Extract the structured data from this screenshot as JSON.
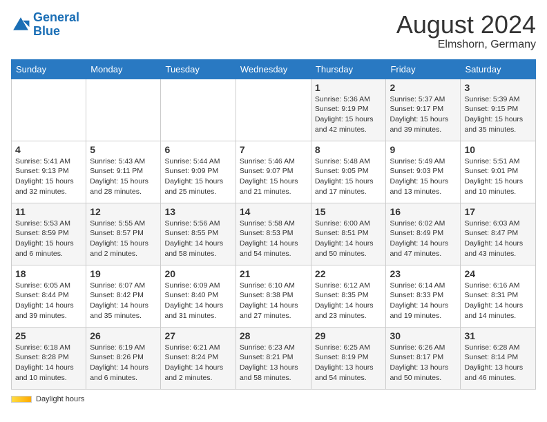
{
  "header": {
    "logo_general": "General",
    "logo_blue": "Blue",
    "month_year": "August 2024",
    "location": "Elmshorn, Germany"
  },
  "days_of_week": [
    "Sunday",
    "Monday",
    "Tuesday",
    "Wednesday",
    "Thursday",
    "Friday",
    "Saturday"
  ],
  "weeks": [
    [
      {
        "num": "",
        "info": ""
      },
      {
        "num": "",
        "info": ""
      },
      {
        "num": "",
        "info": ""
      },
      {
        "num": "",
        "info": ""
      },
      {
        "num": "1",
        "info": "Sunrise: 5:36 AM\nSunset: 9:19 PM\nDaylight: 15 hours\nand 42 minutes."
      },
      {
        "num": "2",
        "info": "Sunrise: 5:37 AM\nSunset: 9:17 PM\nDaylight: 15 hours\nand 39 minutes."
      },
      {
        "num": "3",
        "info": "Sunrise: 5:39 AM\nSunset: 9:15 PM\nDaylight: 15 hours\nand 35 minutes."
      }
    ],
    [
      {
        "num": "4",
        "info": "Sunrise: 5:41 AM\nSunset: 9:13 PM\nDaylight: 15 hours\nand 32 minutes."
      },
      {
        "num": "5",
        "info": "Sunrise: 5:43 AM\nSunset: 9:11 PM\nDaylight: 15 hours\nand 28 minutes."
      },
      {
        "num": "6",
        "info": "Sunrise: 5:44 AM\nSunset: 9:09 PM\nDaylight: 15 hours\nand 25 minutes."
      },
      {
        "num": "7",
        "info": "Sunrise: 5:46 AM\nSunset: 9:07 PM\nDaylight: 15 hours\nand 21 minutes."
      },
      {
        "num": "8",
        "info": "Sunrise: 5:48 AM\nSunset: 9:05 PM\nDaylight: 15 hours\nand 17 minutes."
      },
      {
        "num": "9",
        "info": "Sunrise: 5:49 AM\nSunset: 9:03 PM\nDaylight: 15 hours\nand 13 minutes."
      },
      {
        "num": "10",
        "info": "Sunrise: 5:51 AM\nSunset: 9:01 PM\nDaylight: 15 hours\nand 10 minutes."
      }
    ],
    [
      {
        "num": "11",
        "info": "Sunrise: 5:53 AM\nSunset: 8:59 PM\nDaylight: 15 hours\nand 6 minutes."
      },
      {
        "num": "12",
        "info": "Sunrise: 5:55 AM\nSunset: 8:57 PM\nDaylight: 15 hours\nand 2 minutes."
      },
      {
        "num": "13",
        "info": "Sunrise: 5:56 AM\nSunset: 8:55 PM\nDaylight: 14 hours\nand 58 minutes."
      },
      {
        "num": "14",
        "info": "Sunrise: 5:58 AM\nSunset: 8:53 PM\nDaylight: 14 hours\nand 54 minutes."
      },
      {
        "num": "15",
        "info": "Sunrise: 6:00 AM\nSunset: 8:51 PM\nDaylight: 14 hours\nand 50 minutes."
      },
      {
        "num": "16",
        "info": "Sunrise: 6:02 AM\nSunset: 8:49 PM\nDaylight: 14 hours\nand 47 minutes."
      },
      {
        "num": "17",
        "info": "Sunrise: 6:03 AM\nSunset: 8:47 PM\nDaylight: 14 hours\nand 43 minutes."
      }
    ],
    [
      {
        "num": "18",
        "info": "Sunrise: 6:05 AM\nSunset: 8:44 PM\nDaylight: 14 hours\nand 39 minutes."
      },
      {
        "num": "19",
        "info": "Sunrise: 6:07 AM\nSunset: 8:42 PM\nDaylight: 14 hours\nand 35 minutes."
      },
      {
        "num": "20",
        "info": "Sunrise: 6:09 AM\nSunset: 8:40 PM\nDaylight: 14 hours\nand 31 minutes."
      },
      {
        "num": "21",
        "info": "Sunrise: 6:10 AM\nSunset: 8:38 PM\nDaylight: 14 hours\nand 27 minutes."
      },
      {
        "num": "22",
        "info": "Sunrise: 6:12 AM\nSunset: 8:35 PM\nDaylight: 14 hours\nand 23 minutes."
      },
      {
        "num": "23",
        "info": "Sunrise: 6:14 AM\nSunset: 8:33 PM\nDaylight: 14 hours\nand 19 minutes."
      },
      {
        "num": "24",
        "info": "Sunrise: 6:16 AM\nSunset: 8:31 PM\nDaylight: 14 hours\nand 14 minutes."
      }
    ],
    [
      {
        "num": "25",
        "info": "Sunrise: 6:18 AM\nSunset: 8:28 PM\nDaylight: 14 hours\nand 10 minutes."
      },
      {
        "num": "26",
        "info": "Sunrise: 6:19 AM\nSunset: 8:26 PM\nDaylight: 14 hours\nand 6 minutes."
      },
      {
        "num": "27",
        "info": "Sunrise: 6:21 AM\nSunset: 8:24 PM\nDaylight: 14 hours\nand 2 minutes."
      },
      {
        "num": "28",
        "info": "Sunrise: 6:23 AM\nSunset: 8:21 PM\nDaylight: 13 hours\nand 58 minutes."
      },
      {
        "num": "29",
        "info": "Sunrise: 6:25 AM\nSunset: 8:19 PM\nDaylight: 13 hours\nand 54 minutes."
      },
      {
        "num": "30",
        "info": "Sunrise: 6:26 AM\nSunset: 8:17 PM\nDaylight: 13 hours\nand 50 minutes."
      },
      {
        "num": "31",
        "info": "Sunrise: 6:28 AM\nSunset: 8:14 PM\nDaylight: 13 hours\nand 46 minutes."
      }
    ]
  ],
  "legend": {
    "daylight_label": "Daylight hours"
  }
}
